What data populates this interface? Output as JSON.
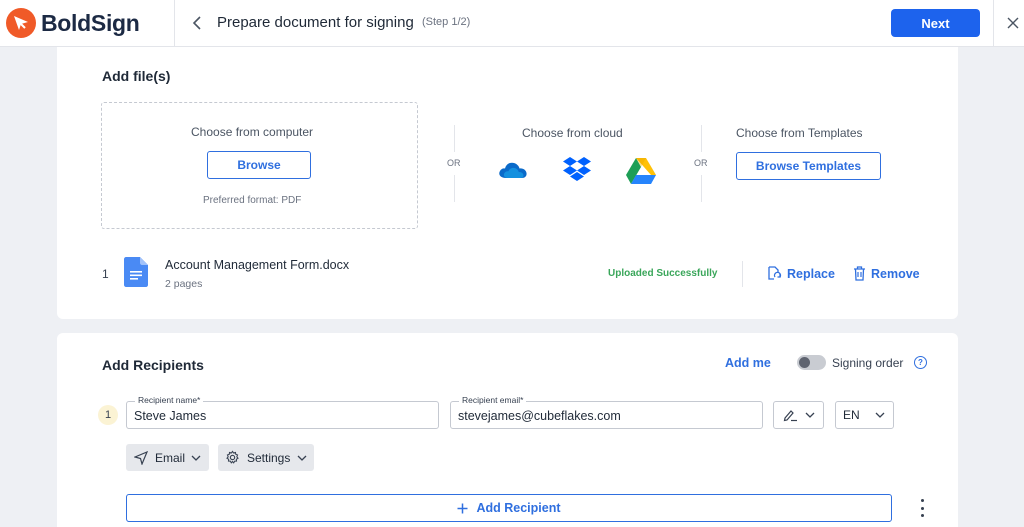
{
  "app": {
    "brand": "BoldSign",
    "brand_color": "#f05a28",
    "accent": "#1d63ed"
  },
  "header": {
    "title": "Prepare document for signing",
    "step": "(Step 1/2)",
    "next_label": "Next"
  },
  "files": {
    "section_title": "Add file(s)",
    "computer": {
      "label": "Choose from computer",
      "button": "Browse",
      "hint": "Preferred format: PDF"
    },
    "or1": "OR",
    "cloud": {
      "label": "Choose from cloud",
      "providers": [
        "onedrive-icon",
        "dropbox-icon",
        "google-drive-icon"
      ]
    },
    "or2": "OR",
    "templates": {
      "label": "Choose from Templates",
      "button": "Browse Templates"
    },
    "uploaded": [
      {
        "index": "1",
        "name": "Account Management Form.docx",
        "pages": "2 pages",
        "status": "Uploaded Successfully",
        "replace": "Replace",
        "remove": "Remove"
      }
    ]
  },
  "recipients": {
    "section_title": "Add Recipients",
    "add_me": "Add me",
    "signing_order_label": "Signing order",
    "signing_order_enabled": false,
    "help": "?",
    "list": [
      {
        "index": "1",
        "name_label": "Recipient name*",
        "name": "Steve James",
        "email_label": "Recipient email*",
        "email": "stevejames@cubeflakes.com",
        "role_icon": "signer-pen-icon",
        "language": "EN",
        "delivery": "Email",
        "settings": "Settings"
      }
    ],
    "add_button": "Add Recipient"
  }
}
